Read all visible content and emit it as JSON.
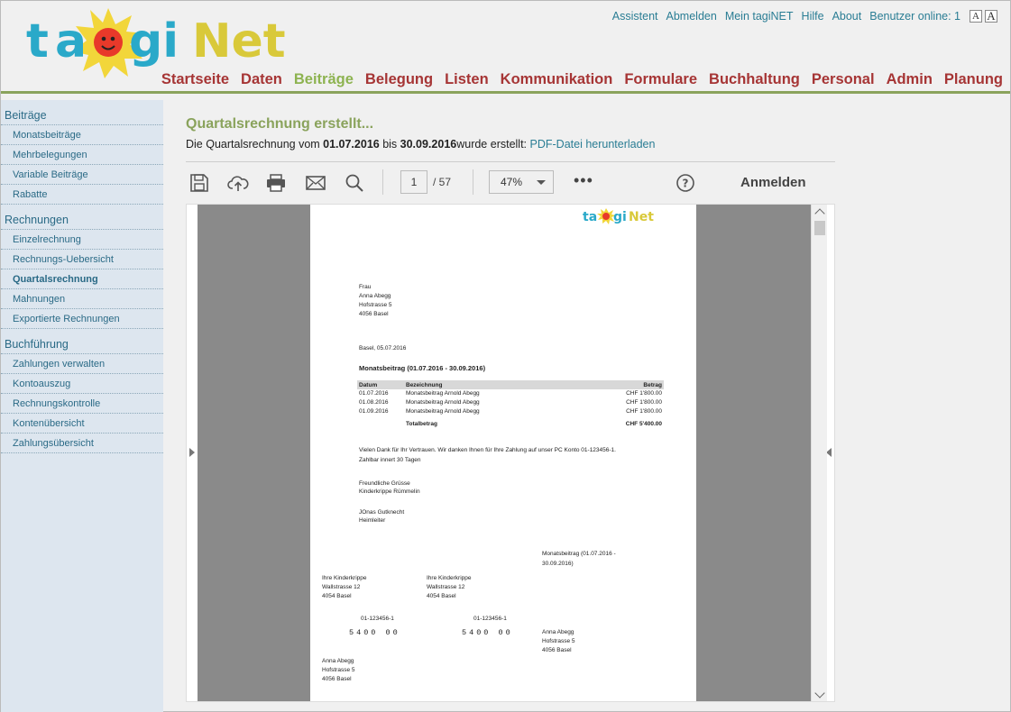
{
  "brand": {
    "logo_text": "tagiNet"
  },
  "toplinks": {
    "assistent": "Assistent",
    "abmelden": "Abmelden",
    "mein_taginet": "Mein tagiNET",
    "hilfe": "Hilfe",
    "about": "About",
    "benutzer_online": "Benutzer online: 1",
    "font_small": "A",
    "font_large": "A"
  },
  "mainnav": [
    {
      "label": "Startseite",
      "active": false
    },
    {
      "label": "Daten",
      "active": false
    },
    {
      "label": "Beiträge",
      "active": true
    },
    {
      "label": "Belegung",
      "active": false
    },
    {
      "label": "Listen",
      "active": false
    },
    {
      "label": "Kommunikation",
      "active": false
    },
    {
      "label": "Formulare",
      "active": false
    },
    {
      "label": "Buchhaltung",
      "active": false
    },
    {
      "label": "Personal",
      "active": false
    },
    {
      "label": "Admin",
      "active": false
    },
    {
      "label": "Planung",
      "active": false
    }
  ],
  "sidebar": {
    "sections": [
      {
        "title": "Beiträge",
        "items": [
          {
            "label": "Monatsbeiträge"
          },
          {
            "label": "Mehrbelegungen"
          },
          {
            "label": "Variable Beiträge"
          },
          {
            "label": "Rabatte"
          }
        ]
      },
      {
        "title": "Rechnungen",
        "items": [
          {
            "label": "Einzelrechnung"
          },
          {
            "label": "Rechnungs-Uebersicht"
          },
          {
            "label": "Quartalsrechnung",
            "active": true
          },
          {
            "label": "Mahnungen"
          },
          {
            "label": "Exportierte Rechnungen"
          }
        ]
      },
      {
        "title": "Buchführung",
        "items": [
          {
            "label": "Zahlungen verwalten"
          },
          {
            "label": "Kontoauszug"
          },
          {
            "label": "Rechnungskontrolle"
          },
          {
            "label": "Kontenübersicht"
          },
          {
            "label": "Zahlungsübersicht"
          }
        ]
      }
    ]
  },
  "content": {
    "title": "Quartalsrechnung erstellt...",
    "line_prefix": "Die Quartalsrechnung vom ",
    "date_from": "01.07.2016",
    "line_mid": " bis ",
    "date_to": "30.09.2016",
    "line_suffix": "wurde erstellt: ",
    "download_link": "PDF-Datei herunterladen"
  },
  "viewer": {
    "page_current": "1",
    "page_total": "/ 57",
    "zoom": "47%",
    "more": "•••",
    "help": "?",
    "login": "Anmelden",
    "icons": [
      "save-icon",
      "cloud-upload-icon",
      "print-icon",
      "mail-icon",
      "search-icon",
      "help-icon"
    ]
  },
  "pdf": {
    "address_lines": [
      "Frau",
      "Anna Abegg",
      "Hofstrasse 5",
      "4056 Basel"
    ],
    "place_date": "Basel, 05.07.2016",
    "heading": "Monatsbeitrag (01.07.2016 - 30.09.2016)",
    "table": {
      "headers": [
        "Datum",
        "Bezeichnung",
        "Betrag"
      ],
      "rows": [
        [
          "01.07.2016",
          "Monatsbeitrag Arnold Abegg",
          "CHF 1'800.00"
        ],
        [
          "01.08.2016",
          "Monatsbeitrag Arnold Abegg",
          "CHF 1'800.00"
        ],
        [
          "01.09.2016",
          "Monatsbeitrag Arnold Abegg",
          "CHF 1'800.00"
        ]
      ],
      "total_label": "Totalbetrag",
      "total_value": "CHF 5'400.00"
    },
    "thanks_1": "Vielen Dank für Ihr Vertrauen. Wir danken Ihnen für Ihre Zahlung auf unser PC Konto 01-123456-1.",
    "thanks_2": "Zahlbar innert 30 Tagen",
    "greeting_1": "Freundliche Grüsse",
    "greeting_2": "Kinderkrippe Rümmelin",
    "signer_1": "JOnas Gutknecht",
    "signer_2": "Heimleiter",
    "slip_ref_1": "Monatsbeitrag (01.07.2016 -",
    "slip_ref_2": "30.09.2016)",
    "payee_left": [
      "Ihre Kinderkrippe",
      "Wallstrasse 12",
      "4054 Basel"
    ],
    "payee_right": [
      "Ihre Kinderkrippe",
      "Wallstrasse 12",
      "4054 Basel"
    ],
    "account_left": "01-123456-1",
    "account_right": "01-123456-1",
    "amount_left": "5400  00",
    "amount_right": "5400  00",
    "payer_right": [
      "Anna Abegg",
      "Hofstrasse 5",
      "4056 Basel"
    ],
    "payer_bottom": [
      "Anna Abegg",
      "Hofstrasse 5",
      "4056 Basel"
    ]
  },
  "colors": {
    "nav_red": "#a63535",
    "nav_active_green": "#8db350",
    "link_teal": "#2a7d94",
    "sidebar_bg": "#dde6ef",
    "pdf_gray": "#8a8a8a"
  }
}
